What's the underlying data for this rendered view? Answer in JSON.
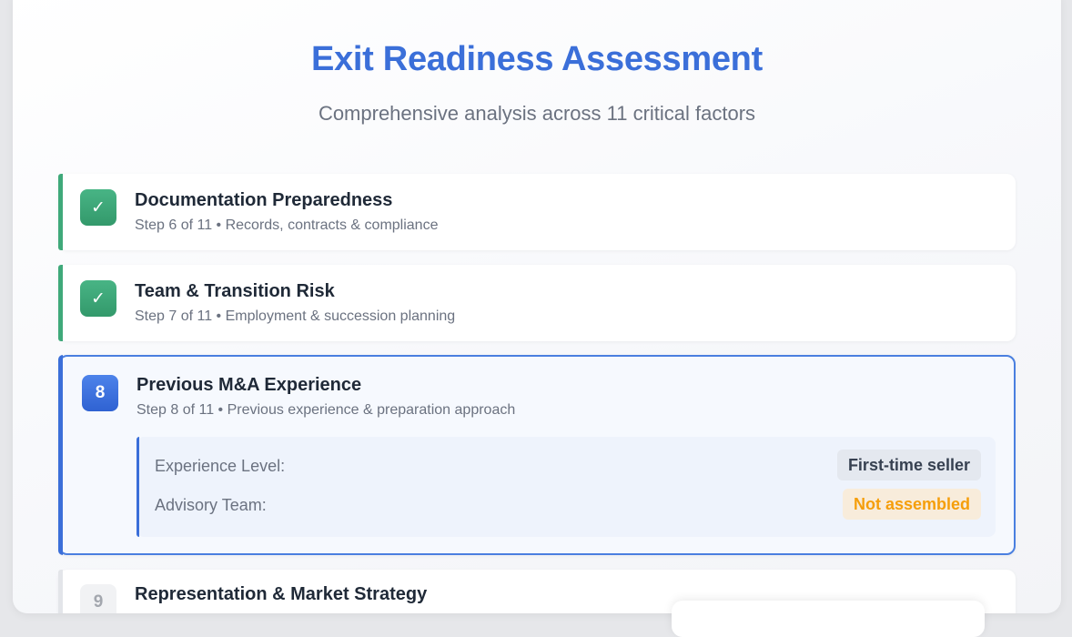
{
  "header": {
    "title": "Exit Readiness Assessment",
    "subtitle": "Comprehensive analysis across 11 critical factors"
  },
  "steps": [
    {
      "status": "done",
      "badge": "✓",
      "title": "Documentation Preparedness",
      "subtitle": "Step 6 of 11 • Records, contracts & compliance"
    },
    {
      "status": "done",
      "badge": "✓",
      "title": "Team & Transition Risk",
      "subtitle": "Step 7 of 11 • Employment & succession planning"
    },
    {
      "status": "active",
      "badge": "8",
      "title": "Previous M&A Experience",
      "subtitle": "Step 8 of 11 • Previous experience & preparation approach",
      "details": [
        {
          "label": "Experience Level:",
          "value": "First-time seller"
        },
        {
          "label": "Advisory Team:",
          "value": "Not assembled"
        }
      ]
    },
    {
      "status": "pending",
      "badge": "9",
      "title": "Representation & Market Strategy"
    }
  ],
  "colors": {
    "accent": "#3b6fd9",
    "done": "#3fa97a",
    "warning": "#f59e0b"
  }
}
